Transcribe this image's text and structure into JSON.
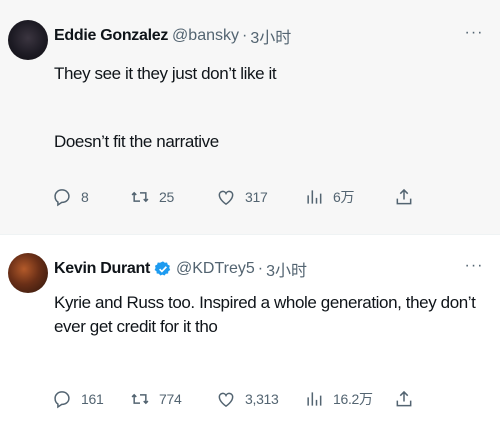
{
  "tweets": [
    {
      "author_name": "Eddie Gonzalez",
      "handle": "@bansky",
      "separator": "·",
      "time": "3小时",
      "more_label": "···",
      "text_line1": "They see it they just don’t like it",
      "text_line2": "Doesn’t fit the narrative",
      "stats": {
        "replies": "8",
        "retweets": "25",
        "likes": "317",
        "views": "6万"
      }
    },
    {
      "author_name": "Kevin Durant",
      "verified": true,
      "handle": "@KDTrey5",
      "separator": "·",
      "time": "3小时",
      "more_label": "···",
      "text": "Kyrie and Russ too. Inspired a whole generation, they don’t ever get credit for it tho",
      "stats": {
        "replies": "161",
        "retweets": "774",
        "likes": "3,313",
        "views": "16.2万"
      }
    }
  ],
  "colors": {
    "muted": "#536471",
    "verified": "#1d9bf0",
    "text": "#0f1419"
  }
}
